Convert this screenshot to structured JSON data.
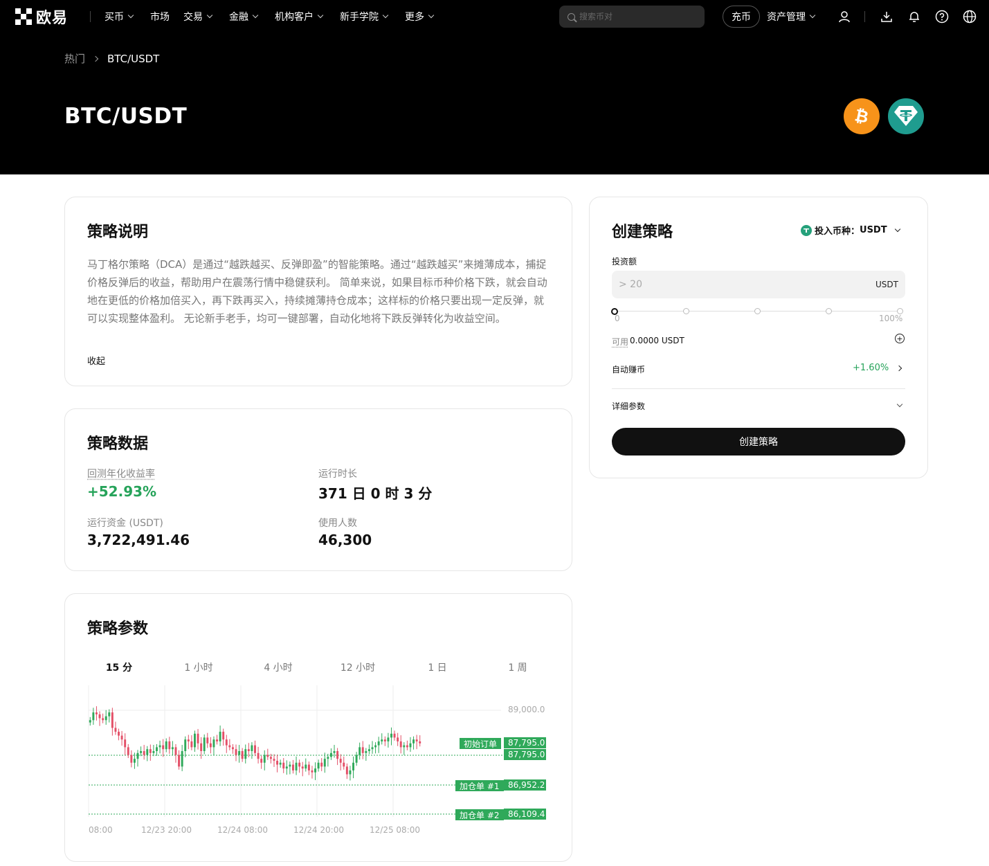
{
  "nav": {
    "logo_text": "欧易",
    "items": [
      {
        "label": "买币",
        "dropdown": true
      },
      {
        "label": "市场",
        "dropdown": false
      },
      {
        "label": "交易",
        "dropdown": true
      },
      {
        "label": "金融",
        "dropdown": true
      },
      {
        "label": "机构客户",
        "dropdown": true
      },
      {
        "label": "新手学院",
        "dropdown": true
      },
      {
        "label": "更多",
        "dropdown": true
      }
    ],
    "search_placeholder": "搜索币对",
    "deposit_label": "充币",
    "assets_label": "资产管理",
    "icons": [
      "user-icon",
      "download-icon",
      "bell-icon",
      "help-icon",
      "globe-icon"
    ]
  },
  "breadcrumb": {
    "parent": "热门",
    "current": "BTC/USDT"
  },
  "header": {
    "title": "BTC/USDT",
    "coins": [
      "bitcoin-icon",
      "tether-icon"
    ]
  },
  "description": {
    "title": "策略说明",
    "text": "马丁格尔策略（DCA）是通过“越跌越买、反弹即盈”的智能策略。通过“越跌越买”来摊薄成本，捕捉价格反弹后的收益，帮助用户在震荡行情中稳健获利。 简单来说，如果目标币种价格下跌，就会自动地在更低的价格加倍买入，再下跌再买入，持续摊薄持仓成本；这样标的价格只要出现一定反弹，就可以实现整体盈利。 无论新手老手，均可一键部署，自动化地将下跌反弹转化为收益空间。",
    "collapse": "收起"
  },
  "stats": {
    "title": "策略数据",
    "annual_label": "回测年化收益率",
    "annual_value": "+52.93%",
    "runtime_label": "运行时长",
    "runtime_value": "371 日 0 时 3 分",
    "funds_label": "运行资金 (USDT)",
    "funds_value": "3,722,491.46",
    "users_label": "使用人数",
    "users_value": "46,300"
  },
  "params": {
    "title": "策略参数",
    "tabs": [
      "15 分",
      "1 小时",
      "4 小时",
      "12 小时",
      "1 日",
      "1 周"
    ],
    "active_tab": 0
  },
  "chart_data": {
    "type": "candlestick",
    "y_tick": "89,000.0",
    "x_ticks": [
      "08:00",
      "12/23 20:00",
      "12/24 08:00",
      "12/24 20:00",
      "12/25 08:00"
    ],
    "orders": [
      {
        "label": "初始订单",
        "price": "87,795.0"
      },
      {
        "label": "",
        "price": "87,795.0"
      },
      {
        "label": "加仓单 #1",
        "price": "86,952.2"
      },
      {
        "label": "加仓单 #2",
        "price": "86,109.4"
      }
    ],
    "candle_closes": [
      88400,
      88600,
      88550,
      88450,
      88400,
      88500,
      88600,
      88200,
      88100,
      88000,
      87900,
      87700,
      87500,
      87300,
      87400,
      87550,
      87600,
      87500,
      87650,
      87550,
      87600,
      87700,
      87750,
      87650,
      87850,
      87650,
      87700,
      87500,
      87200,
      87600,
      87900,
      87850,
      87700,
      88050,
      87800,
      87600,
      87950,
      87800,
      87700,
      87900,
      87850,
      88100,
      87900,
      87750,
      87700,
      87650,
      87500,
      87600,
      87400,
      87650,
      87600,
      87750,
      87550,
      87400,
      87300,
      87500,
      87450,
      87400,
      87350,
      87250,
      87300,
      87150,
      87200,
      87250,
      87100,
      87300,
      87200,
      87150,
      87250,
      87100,
      87050,
      87150,
      87300,
      87200,
      87400,
      87450,
      87550,
      87600,
      87400,
      87300,
      87200,
      87000,
      87100,
      87300,
      87500,
      87700,
      87550,
      87600,
      87650,
      87700,
      87750,
      87850,
      87900,
      87850,
      87950,
      88050,
      87950,
      87850,
      87700,
      87750,
      87700,
      87800,
      87900,
      87850,
      87800
    ],
    "ylim": [
      85900,
      89300
    ],
    "colors": {
      "up": "#2fa95a",
      "down": "#e34f67",
      "line": "#2fa95a"
    }
  },
  "create": {
    "title": "创建策略",
    "currency_label": "投入币种：",
    "currency_value": "USDT",
    "amount_label": "投资额",
    "amount_placeholder": "> 20",
    "amount_unit": "USDT",
    "slider_min": "0",
    "slider_max": "100%",
    "slider_value": 0,
    "available_label": "可用",
    "available_value": "0.0000 USDT",
    "auto_earn_label": "自动赚币",
    "auto_earn_value": "+1.60%",
    "details_label": "详细参数",
    "button_label": "创建策略"
  },
  "colors": {
    "accent_green": "#26a35a",
    "bitcoin": "#f7931a",
    "tether": "#26a17b"
  }
}
